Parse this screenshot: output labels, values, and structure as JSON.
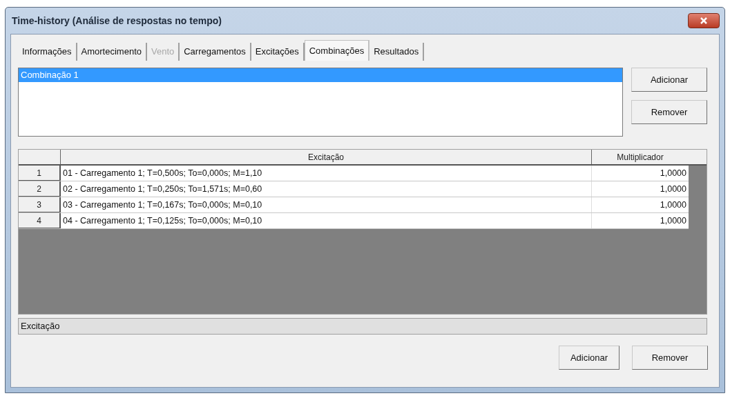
{
  "window": {
    "title": "Time-history (Análise de respostas no tempo)"
  },
  "tabs": [
    {
      "label": "Informações",
      "selected": false,
      "disabled": false
    },
    {
      "label": "Amortecimento",
      "selected": false,
      "disabled": false
    },
    {
      "label": "Vento",
      "selected": false,
      "disabled": true
    },
    {
      "label": "Carregamentos",
      "selected": false,
      "disabled": false
    },
    {
      "label": "Excitações",
      "selected": false,
      "disabled": false
    },
    {
      "label": "Combinações",
      "selected": true,
      "disabled": false
    },
    {
      "label": "Resultados",
      "selected": false,
      "disabled": false
    }
  ],
  "combinations": {
    "items": [
      {
        "label": "Combinação 1",
        "selected": true
      }
    ],
    "buttons": [
      "Adicionar",
      "Remover"
    ]
  },
  "table": {
    "columns": [
      "Excitação",
      "Multiplicador"
    ],
    "rows": [
      {
        "index": "1",
        "excitation": "01 - Carregamento 1; T=0,500s; To=0,000s; M=1,10",
        "multiplier": "1,0000"
      },
      {
        "index": "2",
        "excitation": "02 - Carregamento 1; T=0,250s; To=1,571s; M=0,60",
        "multiplier": "1,0000"
      },
      {
        "index": "3",
        "excitation": "03 - Carregamento 1; T=0,167s; To=0,000s; M=0,10",
        "multiplier": "1,0000"
      },
      {
        "index": "4",
        "excitation": "04 - Carregamento 1; T=0,125s; To=0,000s; M=0,10",
        "multiplier": "1,0000"
      }
    ]
  },
  "status_field": {
    "value": "Excitação"
  },
  "bottom_buttons": [
    "Adicionar",
    "Remover"
  ]
}
